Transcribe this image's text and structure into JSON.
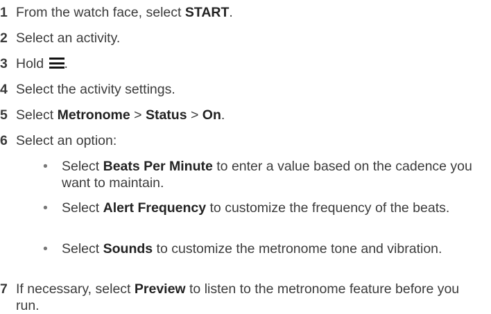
{
  "steps": [
    {
      "num": "1",
      "pre": "From the watch face, select ",
      "bold": "START",
      "post": "."
    },
    {
      "num": "2",
      "text": "Select an activity."
    },
    {
      "num": "3",
      "pre": "Hold ",
      "icon": "menu-icon",
      "post": "."
    },
    {
      "num": "4",
      "text": "Select the activity settings."
    },
    {
      "num": "5",
      "pre": "Select ",
      "b1": "Metronome",
      "sep1": " > ",
      "b2": "Status",
      "sep2": " > ",
      "b3": "On",
      "post": "."
    },
    {
      "num": "6",
      "text": "Select an option:"
    },
    {
      "num": "7",
      "pre": "If necessary, select ",
      "bold": "Preview",
      "post": " to listen to the metronome feature before you run."
    }
  ],
  "options": [
    {
      "bullet": "•",
      "pre": "Select ",
      "bold": "Beats Per Minute",
      "post": " to enter a value based on the cadence you want to maintain."
    },
    {
      "bullet": "•",
      "pre": "Select ",
      "bold": "Alert Frequency",
      "post": " to customize the frequency of the beats."
    },
    {
      "bullet": "•",
      "pre": "Select ",
      "bold": "Sounds",
      "post": " to customize the metronome tone and vibration."
    }
  ]
}
